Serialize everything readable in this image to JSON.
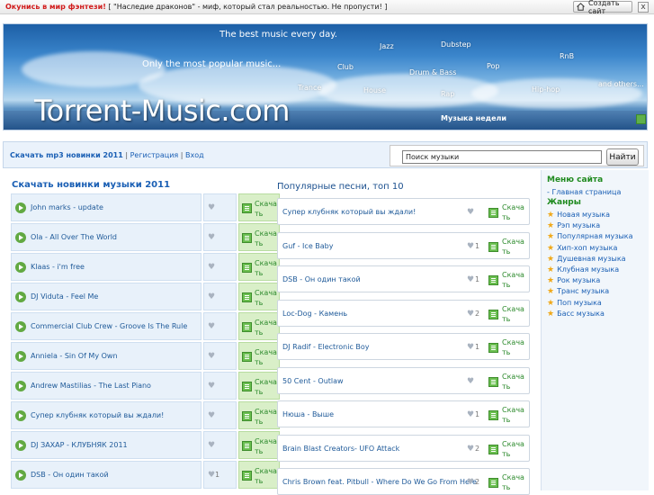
{
  "topbar": {
    "promo_hot": "Окунись в мир фэнтези!",
    "promo_text": "[ \"Наследие драконов\" - миф, который стал реальностью. Не пропусти! ]",
    "create_site": "Создать сайт",
    "close": "x"
  },
  "banner": {
    "tagline_top": "The best music every day.",
    "tagline_mid": "Only the most popular music...",
    "logo": "Torrent-Music.com",
    "genres": [
      "Jazz",
      "Dubstep",
      "Club",
      "Drum & Bass",
      "Pop",
      "RnB",
      "Trance",
      "House",
      "Rap",
      "Hip-hop",
      "and others..."
    ],
    "week_label": "Музыка недели"
  },
  "nav": {
    "download_link": "Скачать mp3 новинки 2011",
    "sep": "|",
    "register": "Регистрация",
    "login": "Вход",
    "search_value": "Поиск музыки",
    "search_button": "Найти"
  },
  "left": {
    "title": "Скачать новинки музыки 2011",
    "download_label": "Скачать",
    "tracks": [
      {
        "title": "John marks - update",
        "likes": ""
      },
      {
        "title": "Ola - All Over The World",
        "likes": ""
      },
      {
        "title": "Klaas - i'm free",
        "likes": ""
      },
      {
        "title": "DJ Viduta - Feel Me",
        "likes": ""
      },
      {
        "title": "Commercial Club Crew - Groove Is The Rule",
        "likes": ""
      },
      {
        "title": "Anniela - Sin Of My Own",
        "likes": ""
      },
      {
        "title": "Andrew Mastilias - The Last Piano",
        "likes": ""
      },
      {
        "title": "Супер клубняк который вы ждали!",
        "likes": ""
      },
      {
        "title": "DJ ЗАХАР - КЛУБНЯК 2011",
        "likes": ""
      },
      {
        "title": "DSB - Он один такой",
        "likes": "1"
      }
    ]
  },
  "right": {
    "title": "Популярные песни, топ 10",
    "download_label": "Скачать",
    "tracks": [
      {
        "title": "Супер клубняк который вы ждали!",
        "likes": ""
      },
      {
        "title": "Guf - Ice Baby",
        "likes": "1"
      },
      {
        "title": "DSB - Он один такой",
        "likes": "1"
      },
      {
        "title": "Loc-Dog - Камень",
        "likes": "2"
      },
      {
        "title": "DJ Radif - Electronic Boy",
        "likes": "1"
      },
      {
        "title": "50 Cent - Outlaw",
        "likes": ""
      },
      {
        "title": "Нюша - Выше",
        "likes": "1"
      },
      {
        "title": "Brain Blast Creators- UFO Attack",
        "likes": "2"
      },
      {
        "title": "Chris Brown feat. Pitbull - Where Do We Go From Here",
        "likes": "2"
      }
    ]
  },
  "sidebar": {
    "menu_title": "Меню сайта",
    "home": "Главная страница",
    "genres_title": "Жанры",
    "genres": [
      "Новая музыка",
      "Рэп музыка",
      "Популярная музыка",
      "Хип-хоп музыка",
      "Душевная музыка",
      "Клубная музыка",
      "Рок музыка",
      "Транс музыка",
      "Поп музыка",
      "Басс музыка"
    ]
  },
  "colors": {
    "link": "#1a5fb4",
    "accent_green": "#62a942",
    "promo_red": "#d11b1b"
  }
}
